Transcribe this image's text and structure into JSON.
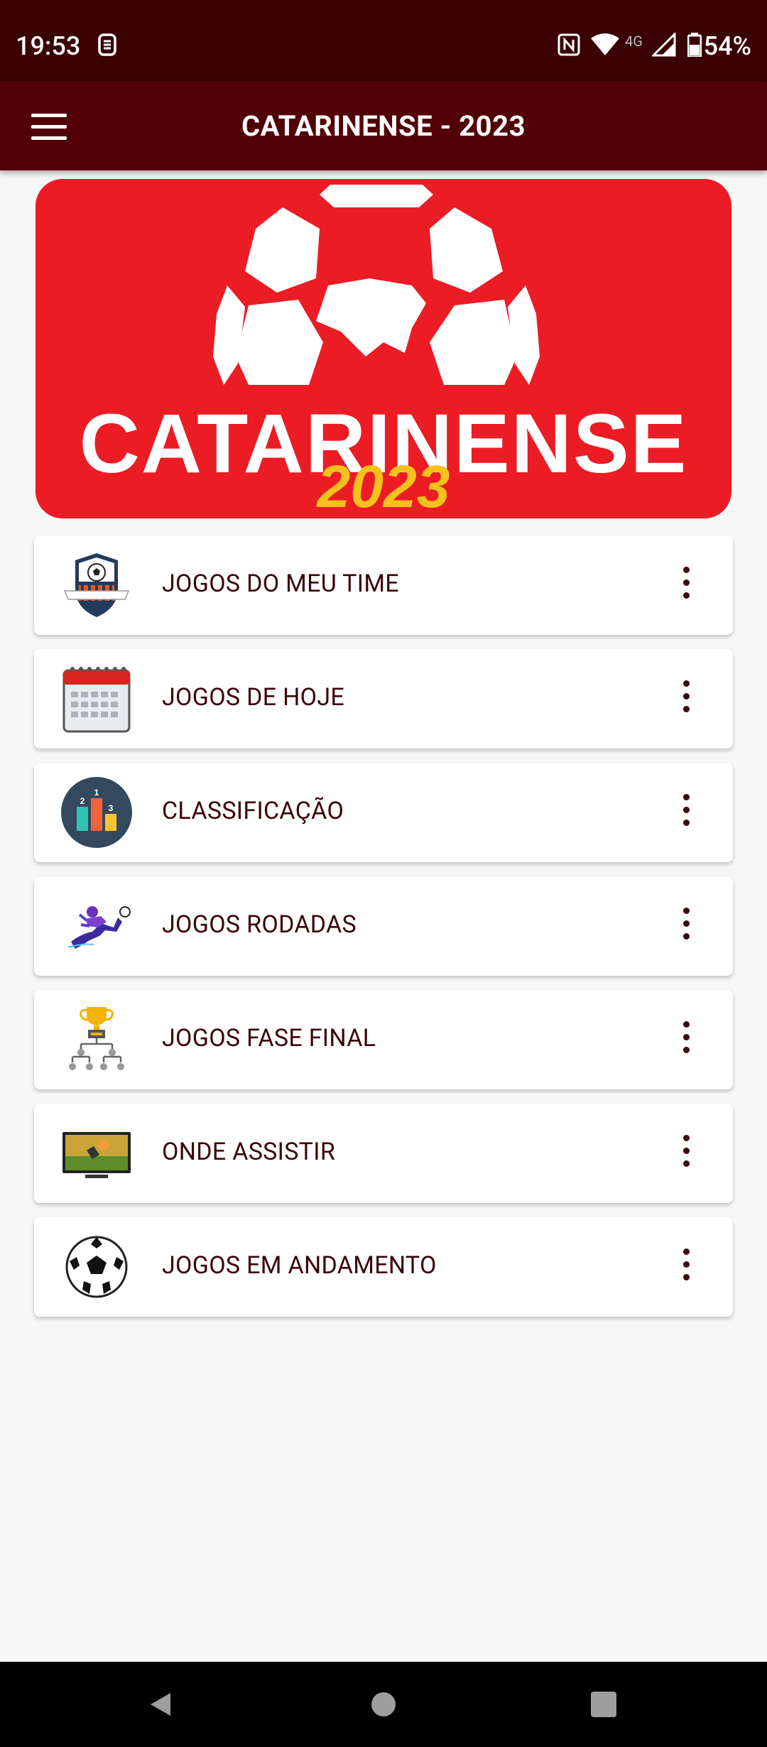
{
  "status": {
    "time": "19:53",
    "network": "4G",
    "battery": "54%"
  },
  "appbar": {
    "title": "CATARINENSE - 2023"
  },
  "banner": {
    "word": "CATARINENSE",
    "year": "2023"
  },
  "menu_items": [
    {
      "label": "JOGOS DO MEU TIME",
      "icon": "team-shield-icon"
    },
    {
      "label": "JOGOS DE HOJE",
      "icon": "calendar-icon"
    },
    {
      "label": "CLASSIFICAÇÃO",
      "icon": "podium-icon"
    },
    {
      "label": "JOGOS RODADAS",
      "icon": "player-kick-icon"
    },
    {
      "label": "JOGOS FASE FINAL",
      "icon": "trophy-bracket-icon"
    },
    {
      "label": "ONDE ASSISTIR",
      "icon": "tv-icon"
    },
    {
      "label": "JOGOS EM ANDAMENTO",
      "icon": "soccer-ball-icon"
    }
  ],
  "colors": {
    "statusbar": "#3a0004",
    "appbar": "#520005",
    "banner": "#ec1c24",
    "year": "#f3c21b",
    "text": "#3a0408"
  }
}
